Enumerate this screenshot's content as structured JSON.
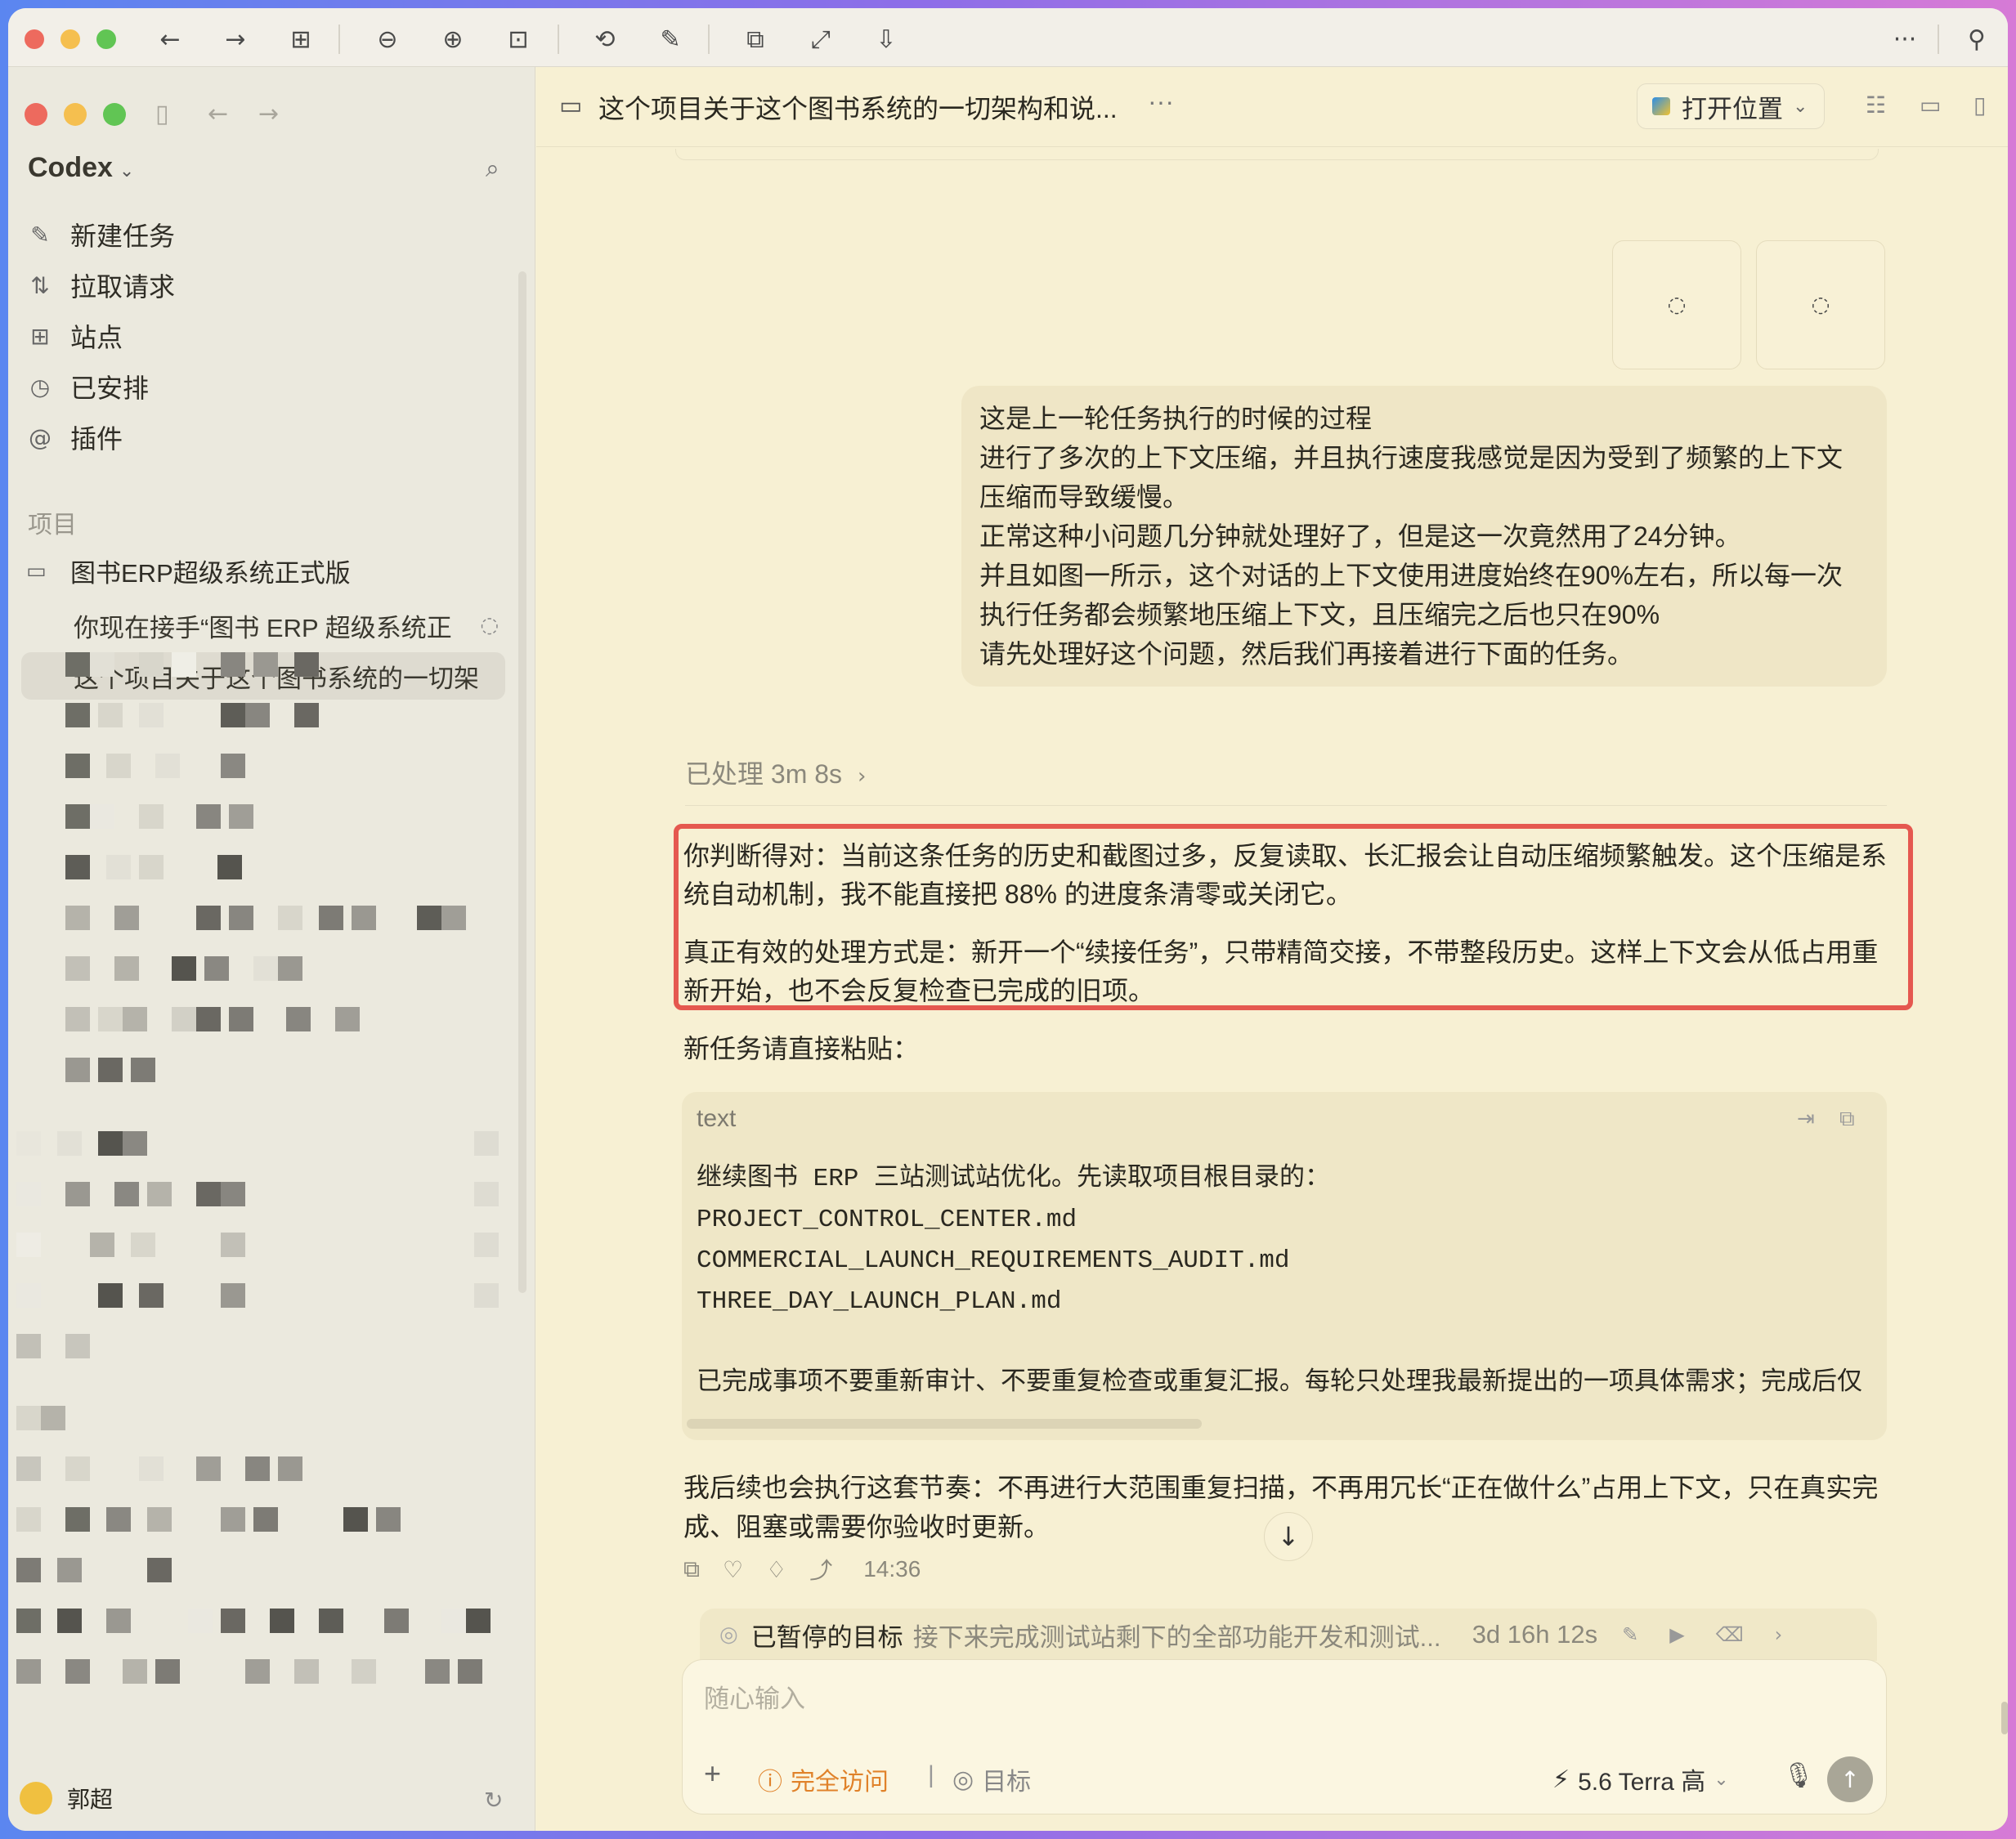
{
  "outer_toolbar": {
    "traffic_colors": [
      "#ed6a5e",
      "#f5bf4f",
      "#61c554"
    ],
    "icons": [
      "chevron-left-icon",
      "chevron-right-icon",
      "grid-icon",
      "zoom-out-icon",
      "zoom-in-icon",
      "actual-size-icon",
      "rotate-icon",
      "markup-icon",
      "crop-icon",
      "fit-icon",
      "share-icon",
      "more-icon",
      "pin-icon"
    ],
    "icon_glyphs": {
      "back": "←",
      "forward": "→",
      "grid": "⊞",
      "zoom_out": "⊖",
      "zoom_in": "⊕",
      "actual": "⊡",
      "rotate": "⟲",
      "markup": "✎",
      "crop": "⧉",
      "fit": "⤢",
      "share": "⇩",
      "more": "···",
      "pin": "⚲"
    }
  },
  "sidebar": {
    "app_name": "Codex",
    "nav": [
      {
        "label": "新建任务",
        "icon": "edit-icon",
        "glyph": "✎"
      },
      {
        "label": "拉取请求",
        "icon": "pull-request-icon",
        "glyph": "⇅"
      },
      {
        "label": "站点",
        "icon": "apps-icon",
        "glyph": "⊞"
      },
      {
        "label": "已安排",
        "icon": "clock-icon",
        "glyph": "◷"
      },
      {
        "label": "插件",
        "icon": "at-icon",
        "glyph": "@"
      }
    ],
    "section_label": "项目",
    "project": {
      "label": "图书ERP超级系统正式版",
      "glyph": "▭"
    },
    "threads": [
      {
        "label": "你现在接手“图书 ERP 超级系统正"
      },
      {
        "label": "这个项目关于这个图书系统的一切架"
      }
    ],
    "footer_name": "郭超"
  },
  "header": {
    "title": "这个项目关于这个图书系统的一切架构和说...",
    "more": "···",
    "open_button": "打开位置"
  },
  "thumbnails": [
    "◌",
    "◌"
  ],
  "user_message": {
    "lines": [
      "这是上一轮任务执行的时候的过程",
      "进行了多次的上下文压缩，并且执行速度我感觉是因为受到了频繁的上下文",
      "压缩而导致缓慢。",
      "正常这种小问题几分钟就处理好了，但是这一次竟然用了24分钟。",
      "并且如图一所示，这个对话的上下文使用进度始终在90%左右，所以每一次",
      "执行任务都会频繁地压缩上下文，且压缩完之后也只在90%",
      "请先处理好这个问题，然后我们再接着进行下面的任务。"
    ]
  },
  "processed": "已处理 3m 8s",
  "response": {
    "p1": [
      "你判断得对：当前这条任务的历史和截图过多，反复读取、长汇报会让自动压缩频繁触发。这个压缩是系",
      "统自动机制，我不能直接把 88% 的进度条清零或关闭它。"
    ],
    "p2": [
      "真正有效的处理方式是：新开一个“续接任务”，只带精简交接，不带整段历史。这样上下文会从低占用重",
      "新开始，也不会反复检查已完成的旧项。"
    ],
    "paste_intro": "新任务请直接粘贴：",
    "code_lang": "text",
    "code_lines": [
      "继续图书 ERP 三站测试站优化。先读取项目根目录的：",
      "PROJECT_CONTROL_CENTER.md",
      "COMMERCIAL_LAUNCH_REQUIREMENTS_AUDIT.md",
      "THREE_DAY_LAUNCH_PLAN.md",
      "",
      "已完成事项不要重新审计、不要重复检查或重复汇报。每轮只处理我最新提出的一项具体需求；完成后仅"
    ],
    "tail": [
      "我后续也会执行这套节奏：不再进行大范围重复扫描，不再用冗长“正在做什么”占用上下文，只在真实完",
      "成、阻塞或需要你验收时更新。"
    ],
    "time": "14:36"
  },
  "goal": {
    "label": "已暂停的目标",
    "desc": "接下来完成测试站剩下的全部功能开发和测试...",
    "time": "3d 16h 12s"
  },
  "composer": {
    "placeholder": "随心输入",
    "plus": "+",
    "access_label": "完全访问",
    "goal_label": "目标",
    "model_label": "5.6 Terra 高"
  },
  "colors": {
    "highlight_border": "#e5584f",
    "access_orange": "#e0822a"
  }
}
